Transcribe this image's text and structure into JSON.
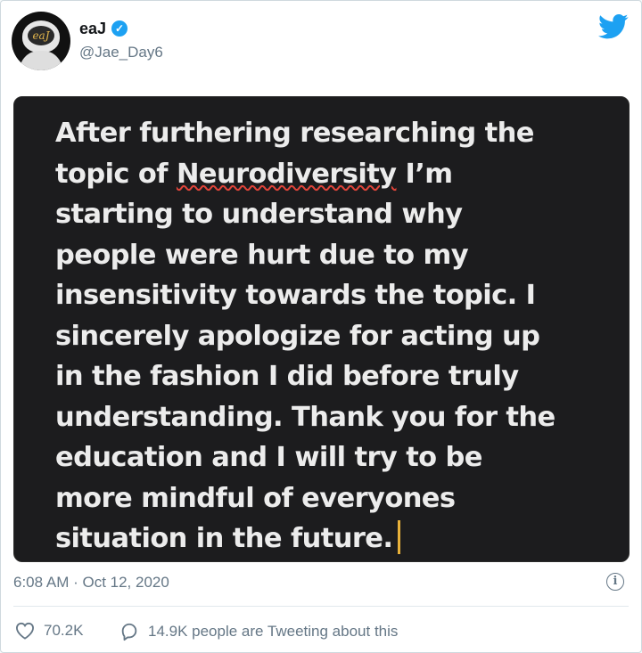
{
  "user": {
    "display_name": "eaJ",
    "handle": "@Jae_Day6",
    "avatar_text": "eaJ",
    "verified_icon": "verified-check-icon"
  },
  "brand": {
    "icon": "twitter-bird-icon",
    "color": "#1da1f2"
  },
  "tweet": {
    "lines": [
      "After furthering researching the",
      "topic of ",
      "Neurodiversity",
      " I’m",
      "starting to understand why",
      "people were hurt due to my",
      "insensitivity towards the topic. I",
      "sincerely apologize for acting up",
      "in the fashion I did before truly",
      "understanding. Thank you for the",
      "education and I will try to be",
      "more mindful of everyones",
      "situation in the future."
    ],
    "image_bg": "#1c1c1e",
    "spellcheck_color": "#e0443a",
    "cursor_color": "#e8b13a"
  },
  "meta": {
    "timestamp": "6:08 AM · Oct 12, 2020",
    "info_icon": "info-icon"
  },
  "actions": {
    "like_count": "70.2K",
    "talk_label": "14.9K people are Tweeting about this"
  }
}
